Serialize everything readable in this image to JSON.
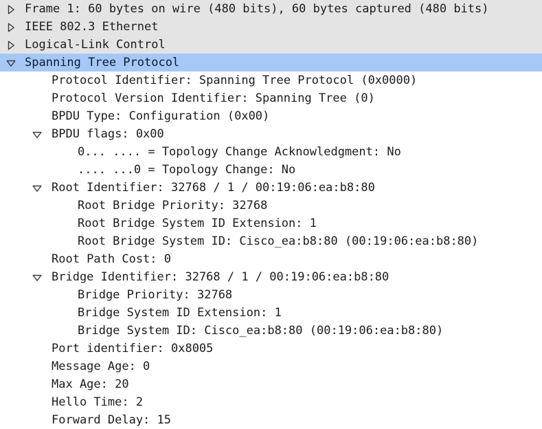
{
  "pane": {
    "name": "packet-details-tree",
    "colors": {
      "background": "#ffffff",
      "alt_row": "#e4e4e4",
      "selection": "#a6c8f7",
      "text": "#1c1c1c",
      "selected_text": "#101a2e"
    }
  },
  "icons": {
    "collapsed": "triangle-right-icon",
    "expanded": "triangle-down-icon"
  },
  "rows": [
    {
      "label": "Frame 1: 60 bytes on wire (480 bits), 60 bytes captured (480 bits)",
      "indent": 0,
      "toggle": "collapsed",
      "striped": true,
      "selected": false
    },
    {
      "label": "IEEE 802.3 Ethernet",
      "indent": 0,
      "toggle": "collapsed",
      "striped": true,
      "selected": false
    },
    {
      "label": "Logical-Link Control",
      "indent": 0,
      "toggle": "collapsed",
      "striped": true,
      "selected": false
    },
    {
      "label": "Spanning Tree Protocol",
      "indent": 0,
      "toggle": "expanded",
      "striped": false,
      "selected": true
    },
    {
      "label": "Protocol Identifier: Spanning Tree Protocol (0x0000)",
      "indent": 1,
      "toggle": "none",
      "striped": false,
      "selected": false
    },
    {
      "label": "Protocol Version Identifier: Spanning Tree (0)",
      "indent": 1,
      "toggle": "none",
      "striped": false,
      "selected": false
    },
    {
      "label": "BPDU Type: Configuration (0x00)",
      "indent": 1,
      "toggle": "none",
      "striped": false,
      "selected": false
    },
    {
      "label": "BPDU flags: 0x00",
      "indent": 1,
      "toggle": "expanded",
      "striped": false,
      "selected": false
    },
    {
      "label": "0... .... = Topology Change Acknowledgment: No",
      "indent": 2,
      "toggle": "none",
      "striped": false,
      "selected": false
    },
    {
      "label": ".... ...0 = Topology Change: No",
      "indent": 2,
      "toggle": "none",
      "striped": false,
      "selected": false
    },
    {
      "label": "Root Identifier: 32768 / 1 / 00:19:06:ea:b8:80",
      "indent": 1,
      "toggle": "expanded",
      "striped": false,
      "selected": false
    },
    {
      "label": "Root Bridge Priority: 32768",
      "indent": 2,
      "toggle": "none",
      "striped": false,
      "selected": false
    },
    {
      "label": "Root Bridge System ID Extension: 1",
      "indent": 2,
      "toggle": "none",
      "striped": false,
      "selected": false
    },
    {
      "label": "Root Bridge System ID: Cisco_ea:b8:80 (00:19:06:ea:b8:80)",
      "indent": 2,
      "toggle": "none",
      "striped": false,
      "selected": false
    },
    {
      "label": "Root Path Cost: 0",
      "indent": 1,
      "toggle": "none",
      "striped": false,
      "selected": false
    },
    {
      "label": "Bridge Identifier: 32768 / 1 / 00:19:06:ea:b8:80",
      "indent": 1,
      "toggle": "expanded",
      "striped": false,
      "selected": false
    },
    {
      "label": "Bridge Priority: 32768",
      "indent": 2,
      "toggle": "none",
      "striped": false,
      "selected": false
    },
    {
      "label": "Bridge System ID Extension: 1",
      "indent": 2,
      "toggle": "none",
      "striped": false,
      "selected": false
    },
    {
      "label": "Bridge System ID: Cisco_ea:b8:80 (00:19:06:ea:b8:80)",
      "indent": 2,
      "toggle": "none",
      "striped": false,
      "selected": false
    },
    {
      "label": "Port identifier: 0x8005",
      "indent": 1,
      "toggle": "none",
      "striped": false,
      "selected": false
    },
    {
      "label": "Message Age: 0",
      "indent": 1,
      "toggle": "none",
      "striped": false,
      "selected": false
    },
    {
      "label": "Max Age: 20",
      "indent": 1,
      "toggle": "none",
      "striped": false,
      "selected": false
    },
    {
      "label": "Hello Time: 2",
      "indent": 1,
      "toggle": "none",
      "striped": false,
      "selected": false
    },
    {
      "label": "Forward Delay: 15",
      "indent": 1,
      "toggle": "none",
      "striped": false,
      "selected": false
    }
  ]
}
